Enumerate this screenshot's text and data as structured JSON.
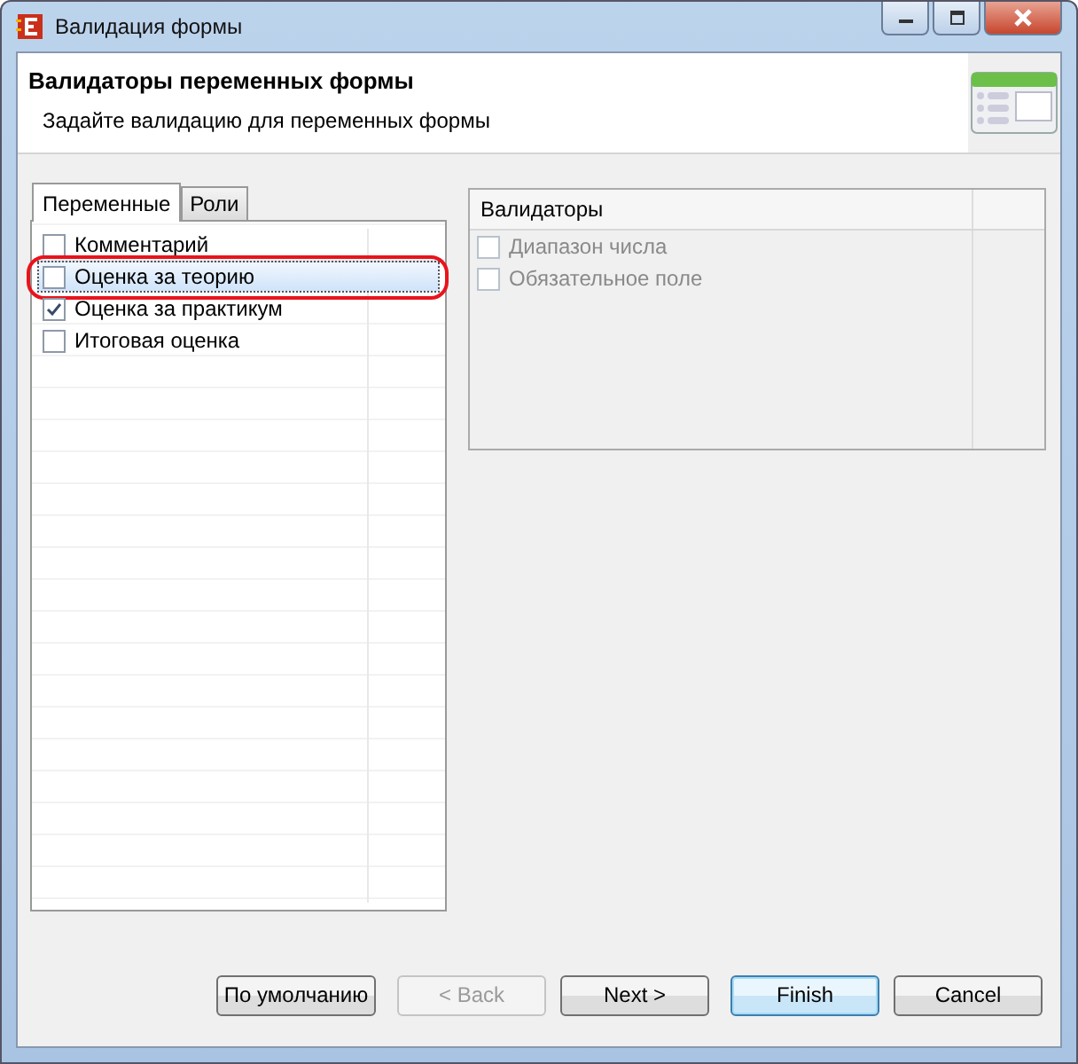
{
  "window": {
    "title": "Валидация формы"
  },
  "header": {
    "title": "Валидаторы переменных формы",
    "subtitle": "Задайте валидацию для переменных формы"
  },
  "tabs": [
    {
      "label": "Переменные",
      "selected": true
    },
    {
      "label": "Роли",
      "selected": false
    }
  ],
  "variables": [
    {
      "label": "Комментарий",
      "checked": false,
      "selected": false,
      "annotated": false
    },
    {
      "label": "Оценка за теорию",
      "checked": false,
      "selected": true,
      "annotated": true
    },
    {
      "label": "Оценка за практикум",
      "checked": true,
      "selected": false,
      "annotated": false
    },
    {
      "label": "Итоговая оценка",
      "checked": false,
      "selected": false,
      "annotated": false
    }
  ],
  "validators": {
    "heading": "Валидаторы",
    "items": [
      {
        "label": "Диапазон числа",
        "checked": false,
        "disabled": true
      },
      {
        "label": "Обязательное поле",
        "checked": false,
        "disabled": true
      }
    ]
  },
  "buttons": [
    {
      "label": "По умолчанию",
      "disabled": false,
      "default": false
    },
    {
      "label": "< Back",
      "disabled": true,
      "default": false
    },
    {
      "label": "Next >",
      "disabled": false,
      "default": false
    },
    {
      "label": "Finish",
      "disabled": false,
      "default": true
    },
    {
      "label": "Cancel",
      "disabled": false,
      "default": false
    }
  ]
}
